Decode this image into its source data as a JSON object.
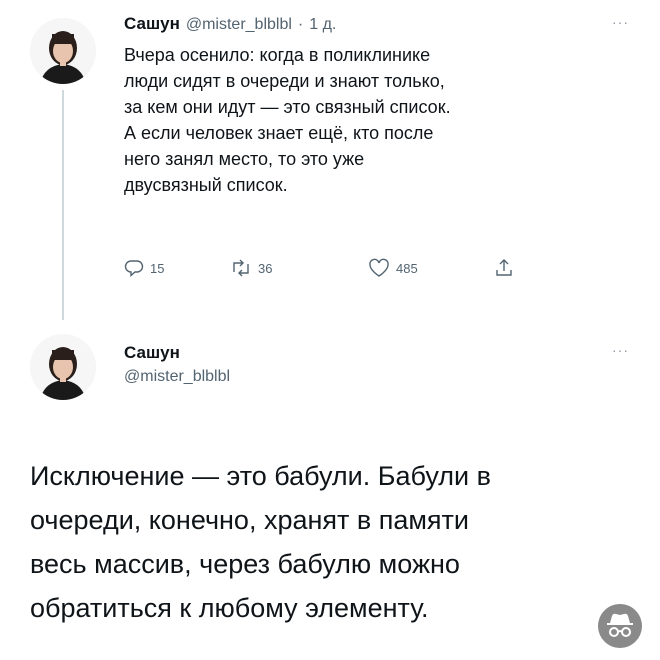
{
  "tweet1": {
    "author_name": "Сашун",
    "handle": "@mister_blblbl",
    "dot": "·",
    "time": "1 д.",
    "more": "···",
    "lines": [
      "Вчера осенило: когда в поликлинике",
      "люди сидят в очереди и знают только,",
      "за кем они идут — это связный список.",
      "А если человек знает ещё, кто после",
      "него занял место, то это уже",
      "двусвязный список."
    ],
    "actions": {
      "replies": "15",
      "retweets": "36",
      "likes": "485"
    }
  },
  "tweet2": {
    "author_name": "Сашун",
    "handle": "@mister_blblbl",
    "more": "···",
    "lines": [
      "Исключение — это бабули. Бабули в",
      "очереди, конечно, хранят в памяти",
      "весь массив, через бабулю можно",
      "обратиться к любому элементу."
    ]
  },
  "colors": {
    "text": "#0f1419",
    "secondary": "#536471",
    "thread_line": "#cfd9de",
    "badge": "#8a8a8a"
  },
  "icons": [
    "reply-icon",
    "retweet-icon",
    "like-icon",
    "share-icon",
    "incognito-icon",
    "more-icon"
  ]
}
